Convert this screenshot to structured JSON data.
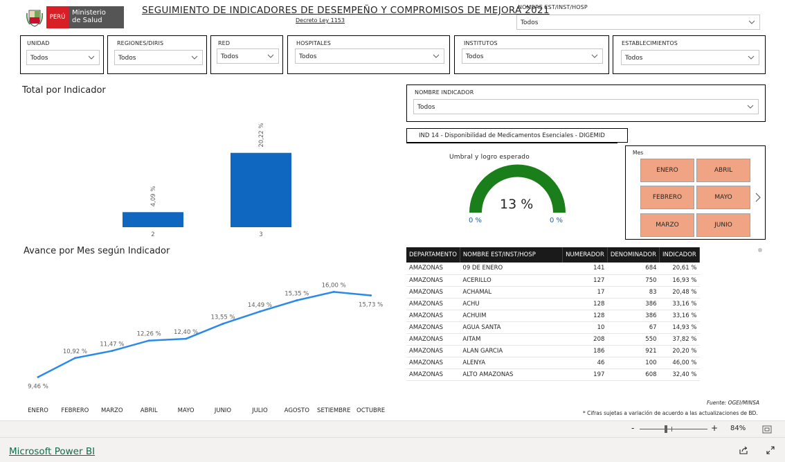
{
  "header": {
    "logo_left": "PERÚ",
    "logo_right_line1": "Ministerio",
    "logo_right_line2": "de Salud",
    "title": "SEGUIMIENTO DE INDICADORES DE DESEMPEÑO Y COMPROMISOS DE MEJORA 2021",
    "subtitle": "Decreto Ley 1153"
  },
  "slicers": {
    "est_inst_hosp": {
      "label": "NOMBRE EST/INST/HOSP",
      "value": "Todos"
    },
    "unidad": {
      "label": "UNIDAD",
      "value": "Todos"
    },
    "regiones": {
      "label": "REGIONES/DIRIS",
      "value": "Todos"
    },
    "red": {
      "label": "RED",
      "value": "Todos"
    },
    "hospitales": {
      "label": "HOSPITALES",
      "value": "Todos"
    },
    "institutos": {
      "label": "INSTITUTOS",
      "value": "Todos"
    },
    "establecimientos": {
      "label": "ESTABLECIMIENTOS",
      "value": "Todos"
    },
    "indicador": {
      "label": "NOMBRE INDICADOR",
      "value": "Todos"
    }
  },
  "indicator_title": "IND 14 - Disponibilidad de Medicamentos Esenciales - DIGEMID",
  "gauge": {
    "title": "Umbral y logro esperado",
    "value_label": "13 %",
    "min_label": "0 %",
    "max_label": "0 %",
    "fill_fraction": 1.0,
    "color": "#1a7f1a"
  },
  "month_slicer": {
    "label": "Mes",
    "buttons": [
      "ENERO",
      "ABRIL",
      "FEBRERO",
      "MAYO",
      "MARZO",
      "JUNIO"
    ],
    "color": "#f0a484"
  },
  "chart_titles": {
    "bar": "Total por Indicador",
    "line": "Avance por Mes según Indicador"
  },
  "chart_data": [
    {
      "type": "bar",
      "categories": [
        "2",
        "3"
      ],
      "values": [
        4.09,
        20.22
      ],
      "data_labels": [
        "4,09 %",
        "20,22 %"
      ],
      "color": "#0f67bf",
      "ylim": [
        0,
        26
      ]
    },
    {
      "type": "line",
      "x": [
        "ENERO",
        "FEBRERO",
        "MARZO",
        "ABRIL",
        "MAYO",
        "JUNIO",
        "JULIO",
        "AGOSTO",
        "SETIEMBRE",
        "OCTUBRE"
      ],
      "values": [
        9.46,
        10.92,
        11.47,
        12.26,
        12.4,
        13.55,
        14.49,
        15.35,
        16.0,
        15.73
      ],
      "data_labels": [
        "9,46 %",
        "10,92 %",
        "11,47 %",
        "12,26 %",
        "12,40 %",
        "13,55 %",
        "14,49 %",
        "15,35 %",
        "16,00 %",
        "15,73 %"
      ],
      "color": "#2b8ae8",
      "ylim": [
        9.0,
        16.5
      ]
    }
  ],
  "table": {
    "headers": [
      "DEPARTAMENTO",
      "NOMBRE EST/INST/HOSP",
      "NUMERADOR",
      "DENOMINADOR",
      "INDICADOR"
    ],
    "rows": [
      [
        "AMAZONAS",
        "09 DE ENERO",
        "141",
        "684",
        "20,61 %"
      ],
      [
        "AMAZONAS",
        "ACERILLO",
        "127",
        "750",
        "16,93 %"
      ],
      [
        "AMAZONAS",
        "ACHAMAL",
        "17",
        "83",
        "20,48 %"
      ],
      [
        "AMAZONAS",
        "ACHU",
        "128",
        "386",
        "33,16 %"
      ],
      [
        "AMAZONAS",
        "ACHUIM",
        "128",
        "386",
        "33,16 %"
      ],
      [
        "AMAZONAS",
        "AGUA SANTA",
        "10",
        "67",
        "14,93 %"
      ],
      [
        "AMAZONAS",
        "AITAM",
        "208",
        "550",
        "37,82 %"
      ],
      [
        "AMAZONAS",
        "ALAN GARCIA",
        "186",
        "921",
        "20,20 %"
      ],
      [
        "AMAZONAS",
        "ALENYA",
        "46",
        "100",
        "46,00 %"
      ],
      [
        "AMAZONAS",
        "ALTO AMAZONAS",
        "197",
        "608",
        "32,40 %"
      ]
    ]
  },
  "notes": {
    "source": "Fuente: OGEI/MINSA",
    "disclaimer": "* Cifras sujetas a variación de acuerdo a las actualizaciones de BD."
  },
  "zoom": {
    "minus": "-",
    "plus": "+",
    "level": "84%"
  },
  "footer": {
    "brand": "Microsoft Power BI"
  }
}
